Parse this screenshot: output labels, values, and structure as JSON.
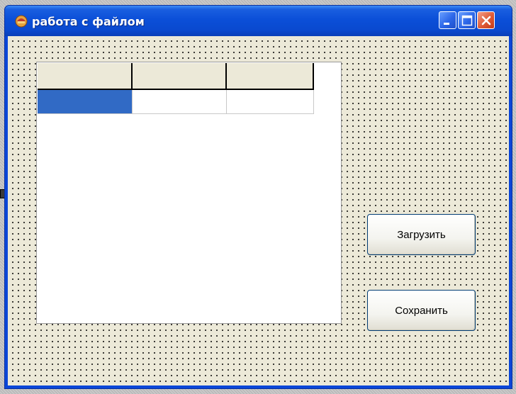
{
  "window": {
    "title": "работа с файлом",
    "icon": "app-helmet-icon",
    "controls": [
      "minimize-icon",
      "maximize-icon",
      "close-icon"
    ]
  },
  "grid": {
    "columns": [
      "",
      "",
      ""
    ],
    "rows": [
      [
        "",
        "",
        ""
      ]
    ],
    "selected_cell": {
      "row": 0,
      "col": 0
    }
  },
  "buttons": {
    "load_label": "Загрузить",
    "save_label": "Сохранить"
  },
  "colors": {
    "titlebar": "#0a4fd8",
    "client": "#ece9d8",
    "selection": "#316ac5",
    "close": "#de5a36"
  }
}
